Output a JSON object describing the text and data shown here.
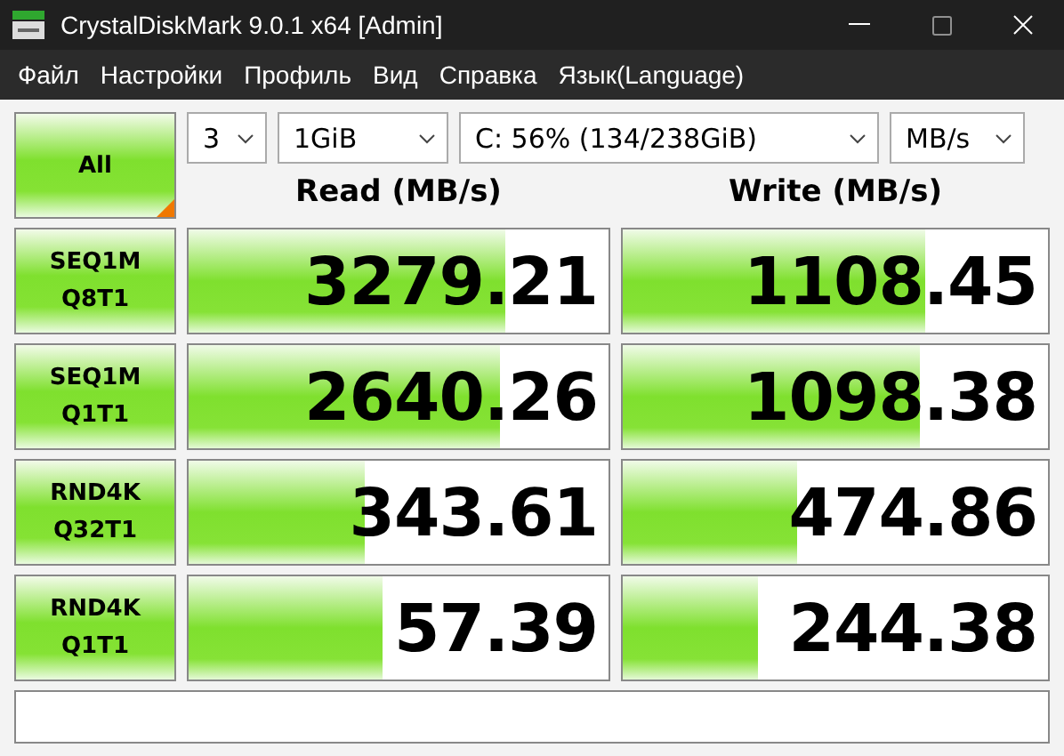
{
  "window": {
    "title": "CrystalDiskMark 9.0.1 x64 [Admin]"
  },
  "menu": [
    "Файл",
    "Настройки",
    "Профиль",
    "Вид",
    "Справка",
    "Язык(Language)"
  ],
  "all_button": {
    "label": "All"
  },
  "selectors": [
    {
      "value": "3"
    },
    {
      "value": "1GiB"
    },
    {
      "value": "C: 56% (134/238GiB)"
    },
    {
      "value": "MB/s"
    }
  ],
  "columns": [
    "Read (MB/s)",
    "Write (MB/s)"
  ],
  "tests": [
    {
      "line1": "SEQ1M",
      "line2": "Q8T1",
      "read": {
        "value": "3279.21",
        "level": 0.755
      },
      "write": {
        "value": "1108.45",
        "level": 0.71
      }
    },
    {
      "line1": "SEQ1M",
      "line2": "Q1T1",
      "read": {
        "value": "2640.26",
        "level": 0.74
      },
      "write": {
        "value": "1098.38",
        "level": 0.7
      }
    },
    {
      "line1": "RND4K",
      "line2": "Q32T1",
      "read": {
        "value": "343.61",
        "level": 0.42
      },
      "write": {
        "value": "474.86",
        "level": 0.41
      }
    },
    {
      "line1": "RND4K",
      "line2": "Q1T1",
      "read": {
        "value": "57.39",
        "level": 0.46
      },
      "write": {
        "value": "244.38",
        "level": 0.32
      }
    }
  ]
}
